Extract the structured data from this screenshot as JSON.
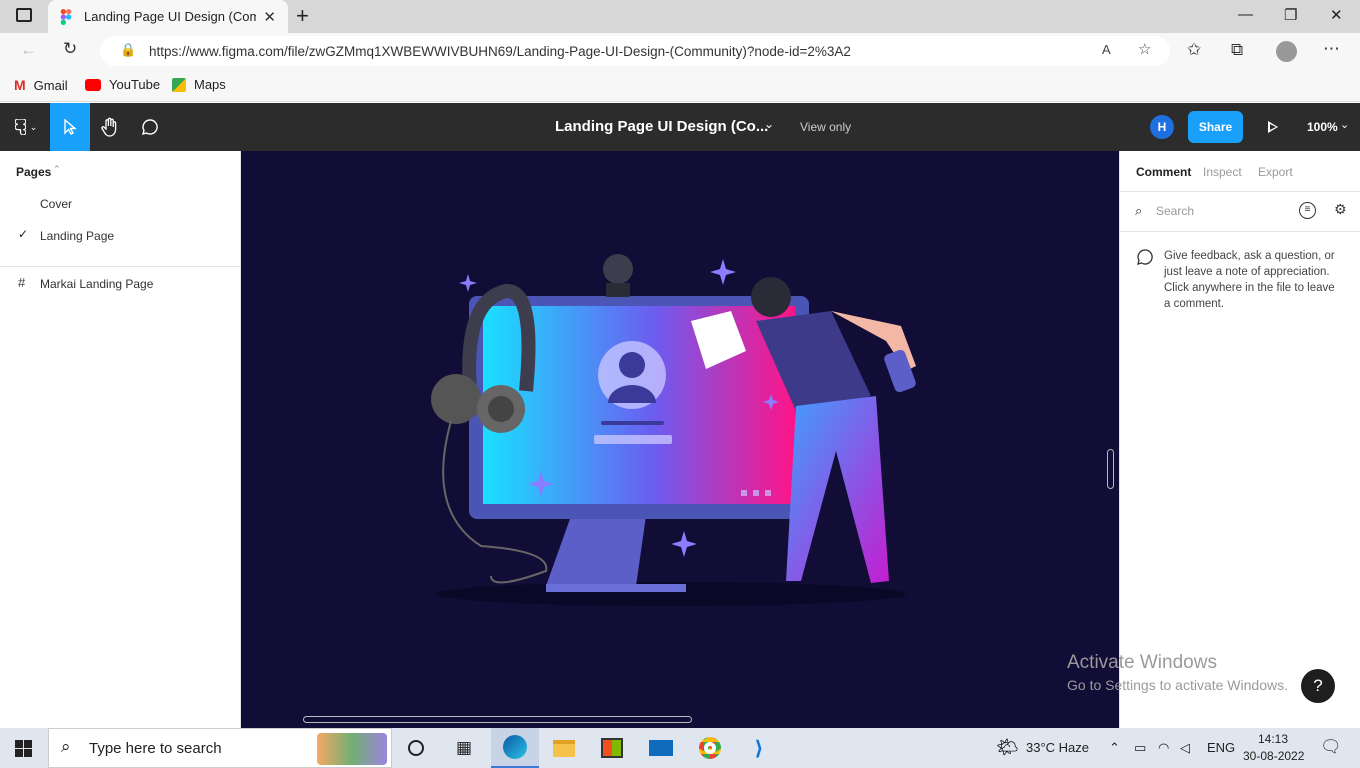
{
  "browser": {
    "tab_title": "Landing Page UI Design (Community) – Figma",
    "url": "https://www.figma.com/file/zwGZMmq1XWBEWWIVBUHN69/Landing-Page-UI-Design-(Community)?node-id=2%3A2",
    "bookmarks": [
      {
        "label": "Gmail",
        "icon": "gmail-icon"
      },
      {
        "label": "YouTube",
        "icon": "youtube-icon"
      },
      {
        "label": "Maps",
        "icon": "maps-icon"
      }
    ]
  },
  "figma": {
    "file_title": "Landing Page UI Design (Co...",
    "view_mode": "View only",
    "avatar_initial": "H",
    "share_label": "Share",
    "zoom": "100%"
  },
  "left_panel": {
    "pages_label": "Pages",
    "pages": [
      {
        "label": "Cover",
        "selected": false
      },
      {
        "label": "Landing Page",
        "selected": true
      }
    ],
    "frame_label": "Markai Landing Page"
  },
  "right_panel": {
    "tabs": [
      "Comment",
      "Inspect",
      "Export"
    ],
    "active_tab": "Comment",
    "search_placeholder": "Search",
    "help_text": "Give feedback, ask a question, or just leave a note of appreciation. Click anywhere in the file to leave a comment."
  },
  "watermark": {
    "line1": "Activate Windows",
    "line2": "Go to Settings to activate Windows."
  },
  "help_button": "?",
  "taskbar": {
    "search_placeholder": "Type here to search",
    "weather": "33°C  Haze",
    "language": "ENG",
    "time": "14:13",
    "date": "30-08-2022"
  },
  "colors": {
    "canvas_bg": "#110d36",
    "figma_blue": "#18a0fb",
    "toolbar_bg": "#2c2c2c"
  }
}
